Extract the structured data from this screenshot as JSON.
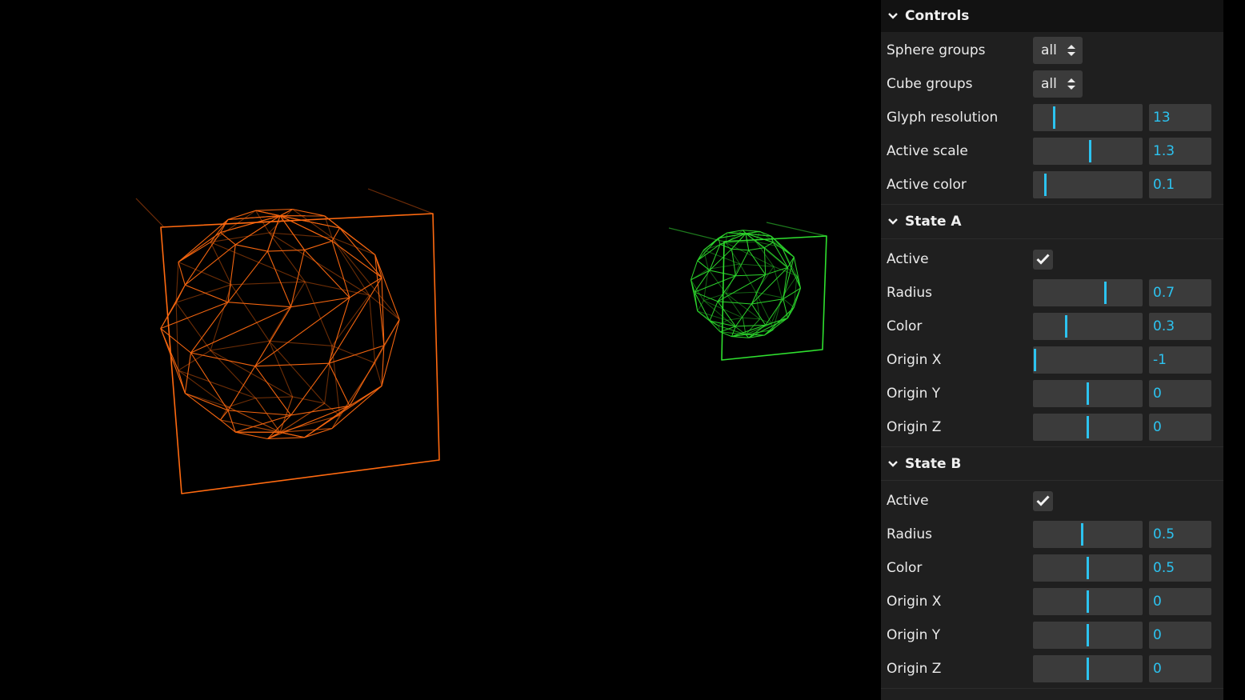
{
  "scene": {
    "background": "#000000",
    "objects": [
      {
        "name": "orange-sphere-glyph",
        "color": "#ff6a10"
      },
      {
        "name": "green-sphere-glyph",
        "color": "#2fe02f"
      }
    ]
  },
  "controls": {
    "title": "Controls",
    "sphere_groups": {
      "label": "Sphere groups",
      "value": "all"
    },
    "cube_groups": {
      "label": "Cube groups",
      "value": "all"
    },
    "glyph_resolution": {
      "label": "Glyph resolution",
      "value": "13",
      "fraction": 0.18
    },
    "active_scale": {
      "label": "Active scale",
      "value": "1.3",
      "fraction": 0.53
    },
    "active_color": {
      "label": "Active color",
      "value": "0.1",
      "fraction": 0.1
    }
  },
  "state_a": {
    "title": "State A",
    "active": {
      "label": "Active",
      "checked": true
    },
    "radius": {
      "label": "Radius",
      "value": "0.7",
      "fraction": 0.67
    },
    "color": {
      "label": "Color",
      "value": "0.3",
      "fraction": 0.3
    },
    "origin_x": {
      "label": "Origin X",
      "value": "-1",
      "fraction": 0.0
    },
    "origin_y": {
      "label": "Origin Y",
      "value": "0",
      "fraction": 0.5
    },
    "origin_z": {
      "label": "Origin Z",
      "value": "0",
      "fraction": 0.5
    }
  },
  "state_b": {
    "title": "State B",
    "active": {
      "label": "Active",
      "checked": true
    },
    "radius": {
      "label": "Radius",
      "value": "0.5",
      "fraction": 0.45
    },
    "color": {
      "label": "Color",
      "value": "0.5",
      "fraction": 0.5
    },
    "origin_x": {
      "label": "Origin X",
      "value": "0",
      "fraction": 0.5
    },
    "origin_y": {
      "label": "Origin Y",
      "value": "0",
      "fraction": 0.5
    },
    "origin_z": {
      "label": "Origin Z",
      "value": "0",
      "fraction": 0.5
    }
  },
  "accent_color": "#2cc3f0"
}
